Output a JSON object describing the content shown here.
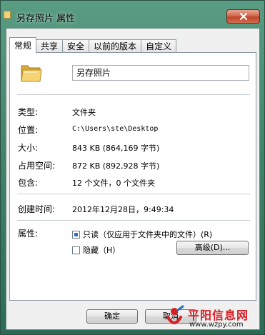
{
  "window": {
    "title": "另存照片 属性"
  },
  "tabs": [
    "常规",
    "共享",
    "安全",
    "以前的版本",
    "自定义"
  ],
  "general": {
    "name_value": "另存照片",
    "type_label": "类型:",
    "type_value": "文件夹",
    "location_label": "位置:",
    "location_value": "C:\\Users\\ste\\Desktop",
    "size_label": "大小:",
    "size_value": "843 KB (864,169 字节)",
    "size_on_disk_label": "占用空间:",
    "size_on_disk_value": "872 KB (892,928 字节)",
    "contains_label": "包含:",
    "contains_value": "12 个文件，0 个文件夹",
    "created_label": "创建时间:",
    "created_value": "2012年12月28日，9:49:34",
    "attributes_label": "属性:",
    "readonly_label": "只读（仅应用于文件夹中的文件）(R)",
    "readonly_checked": true,
    "hidden_label": "隐藏（H）",
    "hidden_checked": false,
    "advanced_button": "高级(D)..."
  },
  "footer": {
    "ok_button": "确定",
    "cancel_button": "取消"
  },
  "watermark": {
    "name": "平阳信息网",
    "url": "www.wzpy.com"
  },
  "colors": {
    "desktop": "#2c7357",
    "close_button": "#c0452c",
    "watermark_red": "#d71f26"
  }
}
